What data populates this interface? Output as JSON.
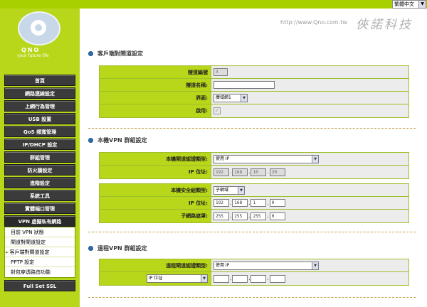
{
  "header": {
    "language": "繁體中文",
    "site_url": "http://www.Qno.com.tw",
    "brand_cn": "俠諾科技",
    "logo_text": "QNO",
    "logo_tagline": "your future life"
  },
  "sidebar": {
    "items": [
      "首頁",
      "網路連線設定",
      "上網行為管理",
      "USB 設置",
      "QoS 頻寬管理",
      "IP/DHCP 設定",
      "群組管理",
      "防火牆設定",
      "進階設定",
      "系統工具",
      "實體端口管理",
      "VPN 虛擬私有網路"
    ],
    "vpn_submenu": [
      "目前 VPN 狀態",
      "閘道對閘道設定",
      "客戶端對閘道設定",
      "PPTP 設定",
      "封包穿透路由功能"
    ],
    "bottom_item": "Full Set SSL"
  },
  "section_client": {
    "title": "客戶端對閘道設定",
    "rows": {
      "tunnel_no_label": "隧道編號",
      "tunnel_no_value": "3",
      "tunnel_name_label": "隧道名稱:",
      "tunnel_name_value": "",
      "interface_label": "界面:",
      "interface_value": "廣域網1",
      "enable_label": "啟用:",
      "enable_mark": "✓"
    }
  },
  "section_local": {
    "title": "本機VPN 群組設定",
    "auth_type_label": "本機閘道認證類型:",
    "auth_type_value": "使用 IP",
    "ip_label": "IP 位址:",
    "ip": [
      "192",
      "168",
      "10",
      "20"
    ],
    "security_group_label": "本機安全組類型:",
    "security_group_value": "子網域",
    "subnet_ip_label": "IP 位址:",
    "subnet_ip": [
      "192",
      "168",
      "1",
      "0"
    ],
    "mask_label": "子網路遮罩:",
    "mask": [
      "255",
      "255",
      "255",
      "0"
    ]
  },
  "section_remote": {
    "title": "遠程VPN 群組設定",
    "auth_type_label": "遠程閘道認證類型:",
    "auth_type_value": "使用 IP",
    "ip_type_value": "IP 位址",
    "ip": [
      "",
      "",
      "",
      ""
    ]
  }
}
